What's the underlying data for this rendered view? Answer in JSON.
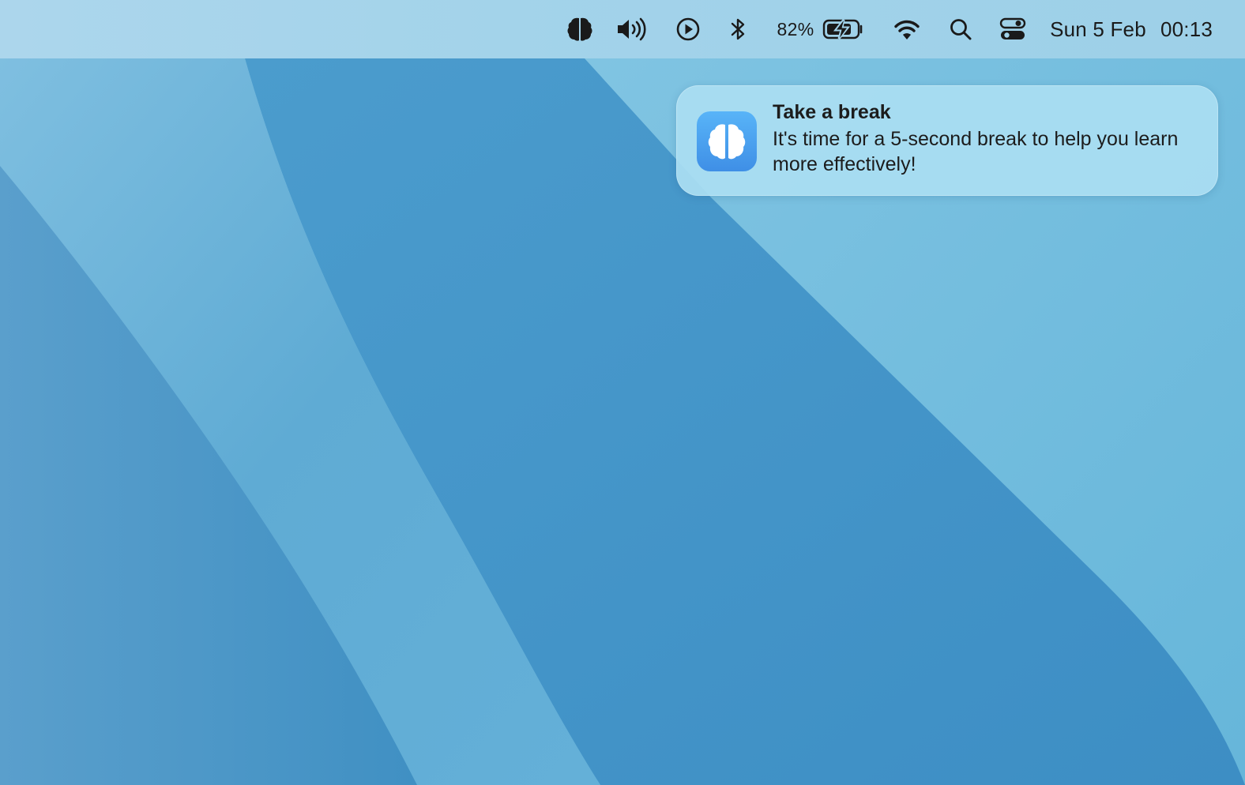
{
  "menubar": {
    "icons": {
      "brain_app": "brain-icon",
      "volume": "speaker-volume-icon",
      "now_playing": "play-circle-icon",
      "bluetooth": "bluetooth-icon",
      "battery": "battery-charging-icon",
      "wifi": "wifi-icon",
      "search": "search-icon",
      "control_center": "control-center-icon"
    },
    "battery_percent": "82%",
    "date": "Sun 5 Feb",
    "time": "00:13"
  },
  "notification": {
    "app_icon": "brain-icon",
    "title": "Take a break",
    "body": "It's time for a 5-second break to help you learn more effectively!"
  },
  "colors": {
    "menubar_bg": "#a3d3ea",
    "wallpaper_light": "#6ab6dc",
    "wallpaper_dark": "#3f8fc4",
    "notification_bg": "#aadef2",
    "app_icon_bg": "#4a9ff0"
  }
}
